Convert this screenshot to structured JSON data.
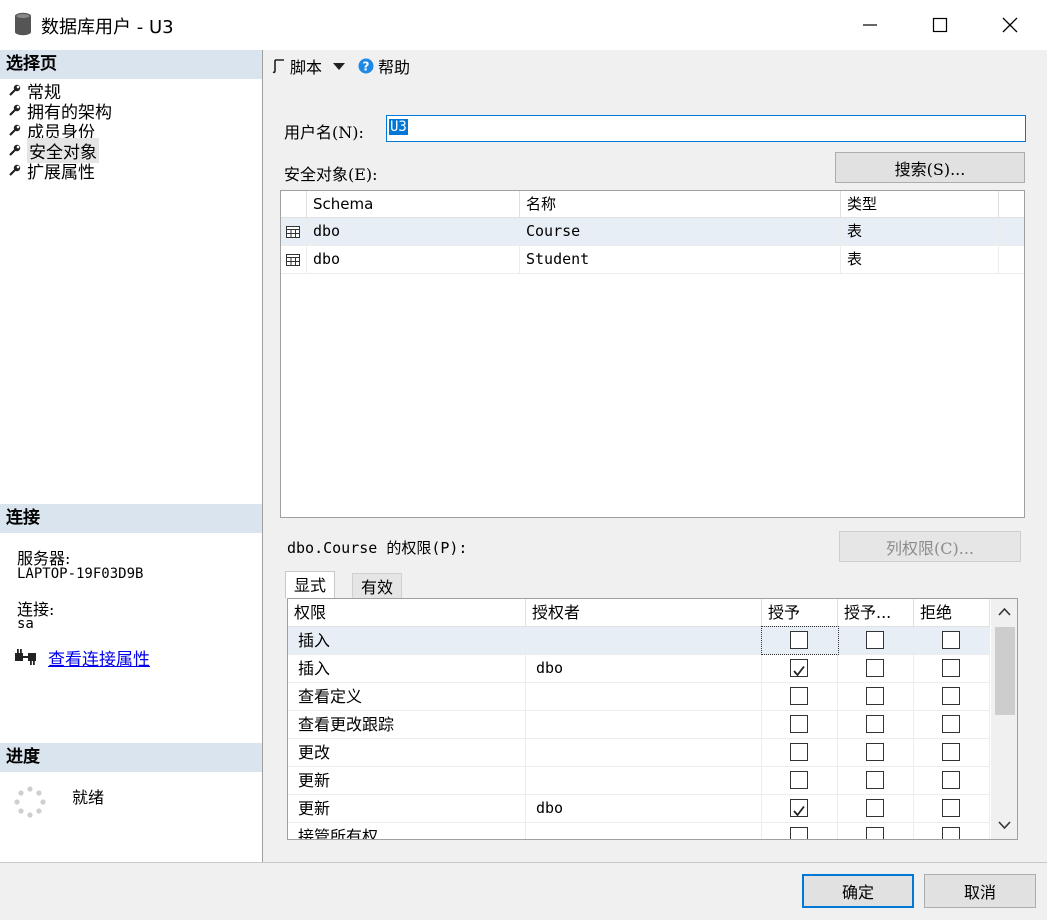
{
  "window": {
    "title": "数据库用户 - U3"
  },
  "left": {
    "select_page_header": "选择页",
    "nav_items": [
      {
        "label": "常规"
      },
      {
        "label": "拥有的架构"
      },
      {
        "label": "成员身份"
      },
      {
        "label": "安全对象"
      },
      {
        "label": "扩展属性"
      }
    ],
    "connection_header": "连接",
    "server_label": "服务器:",
    "server_value": "LAPTOP-19F03D9B",
    "connection_label": "连接:",
    "connection_value": "sa",
    "view_connection_link": "查看连接属性",
    "progress_header": "进度",
    "progress_status": "就绪"
  },
  "toolbar": {
    "script_label": "脚本",
    "help_label": "帮助"
  },
  "form": {
    "username_label": "用户名(N):",
    "username_value": "U3",
    "securables_label": "安全对象(E):",
    "search_button": "搜索(S)...",
    "securables_columns": [
      "Schema",
      "名称",
      "类型"
    ],
    "securables_rows": [
      {
        "schema": "dbo",
        "name": "Course",
        "type": "表"
      },
      {
        "schema": "dbo",
        "name": "Student",
        "type": "表"
      }
    ],
    "permissions_label": "dbo.Course 的权限(P):",
    "column_permissions_button": "列权限(C)...",
    "tabs": [
      {
        "label": "显式"
      },
      {
        "label": "有效"
      }
    ],
    "permissions_columns": [
      "权限",
      "授权者",
      "授予",
      "授予...",
      "拒绝"
    ],
    "permissions_rows": [
      {
        "permission": "插入",
        "grantor": "",
        "grant": false,
        "with_grant": false,
        "deny": false
      },
      {
        "permission": "插入",
        "grantor": "dbo",
        "grant": true,
        "with_grant": false,
        "deny": false
      },
      {
        "permission": "查看定义",
        "grantor": "",
        "grant": false,
        "with_grant": false,
        "deny": false
      },
      {
        "permission": "查看更改跟踪",
        "grantor": "",
        "grant": false,
        "with_grant": false,
        "deny": false
      },
      {
        "permission": "更改",
        "grantor": "",
        "grant": false,
        "with_grant": false,
        "deny": false
      },
      {
        "permission": "更新",
        "grantor": "",
        "grant": false,
        "with_grant": false,
        "deny": false
      },
      {
        "permission": "更新",
        "grantor": "dbo",
        "grant": true,
        "with_grant": false,
        "deny": false
      },
      {
        "permission": "接管所有权",
        "grantor": "",
        "grant": false,
        "with_grant": false,
        "deny": false
      }
    ]
  },
  "footer": {
    "ok_button": "确定",
    "cancel_button": "取消"
  },
  "colors": {
    "section_header": "#d9e4ef",
    "pane_background": "#f0f0f0",
    "selected_row": "#e8eef5",
    "link": "#0000ee",
    "accent": "#0078d7"
  }
}
